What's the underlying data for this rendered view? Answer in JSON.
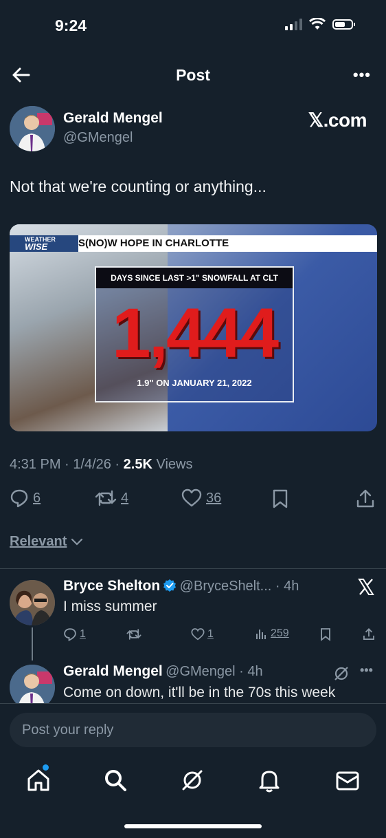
{
  "status": {
    "time": "9:24"
  },
  "nav": {
    "title": "Post"
  },
  "post": {
    "author_name": "Gerald Mengel",
    "author_handle": "@GMengel",
    "source": "𝕏.com",
    "text": "Not that we're counting or anything...",
    "media": {
      "brand_top": "WEATHER",
      "brand_bottom": "WISE",
      "headline": "S(NO)W HOPE IN CHARLOTTE",
      "caption": "DAYS SINCE LAST >1\" SNOWFALL AT CLT",
      "count": "1,444",
      "date": "1.9\" ON JANUARY 21, 2022"
    },
    "time": "4:31 PM",
    "date": "1/4/26",
    "views_count": "2.5K",
    "views_label": "Views",
    "replies": "6",
    "reposts": "4",
    "likes": "36"
  },
  "sort": {
    "label": "Relevant"
  },
  "replies": [
    {
      "name": "Bryce Shelton",
      "handle": "@BryceShelt...",
      "age": "4h",
      "text": "I miss summer",
      "replies": "1",
      "likes": "1",
      "views": "259"
    },
    {
      "name": "Gerald Mengel",
      "handle": "@GMengel",
      "age": "4h",
      "text": "Come on down, it'll be in the 70s this week"
    }
  ],
  "compose": {
    "placeholder": "Post your reply"
  },
  "colors": {
    "accent": "#1d9bf0",
    "background": "#15202b",
    "muted": "#8b98a5",
    "count_red": "#e01c1c"
  }
}
